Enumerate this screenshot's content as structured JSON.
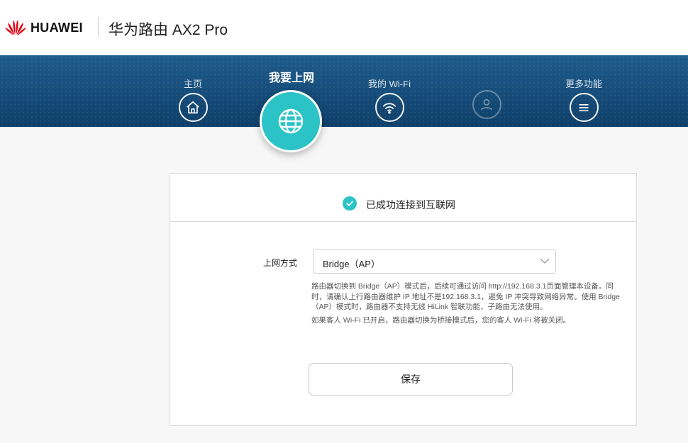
{
  "header": {
    "brand": "HUAWEI",
    "product": "华为路由 AX2 Pro",
    "logo_icon": "huawei-petal-logo",
    "brand_color": "#e60012"
  },
  "nav": {
    "home": {
      "label": "主页",
      "icon": "home-icon"
    },
    "internet": {
      "label": "我要上网",
      "icon": "globe-icon",
      "active": true
    },
    "wifi": {
      "label": "我的 Wi-Fi",
      "icon": "wifi-icon"
    },
    "user": {
      "label": "",
      "icon": "user-icon",
      "disabled": true
    },
    "more": {
      "label": "更多功能",
      "icon": "menu-icon"
    },
    "band_color": "#164b78",
    "accent": "#2cc3c7"
  },
  "status": {
    "icon": "check-circle-icon",
    "text": "已成功连接到互联网"
  },
  "form": {
    "mode_label": "上网方式",
    "mode_value": "Bridge（AP）",
    "help_1": "路由器切换到 Bridge（AP）模式后，后续可通过访问 http://192.168.3.1页面管理本设备。同时，请确认上行路由器维护 IP 地址不是192.168.3.1，避免 IP 冲突导致网络异常。使用 Bridge（AP）模式时，路由器不支持无线 HiLink 智联功能，子路由无法使用。",
    "help_2": "如果客人 Wi-Fi 已开启，路由器切换为桥接模式后，您的客人 Wi-Fi 将被关闭。",
    "save_label": "保存"
  }
}
